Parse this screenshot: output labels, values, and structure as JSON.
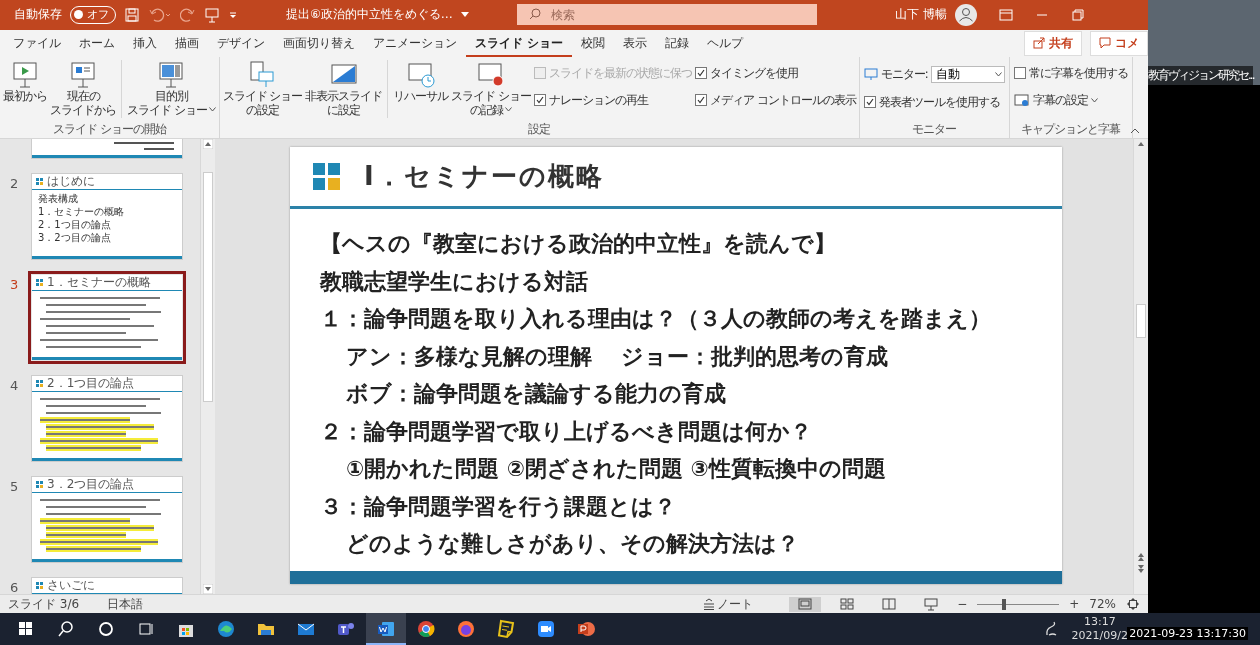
{
  "title_bar": {
    "autosave_label": "自動保存",
    "autosave_toggle": {
      "label": "オフ",
      "on": false
    },
    "document_title": "提出⑥政治的中立性をめぐる…",
    "search": {
      "placeholder": "検索"
    },
    "user_name": "山下 博暢"
  },
  "ribbon_tabs": [
    {
      "label": "ファイル",
      "selected": false
    },
    {
      "label": "ホーム",
      "selected": false
    },
    {
      "label": "挿入",
      "selected": false
    },
    {
      "label": "描画",
      "selected": false
    },
    {
      "label": "デザイン",
      "selected": false
    },
    {
      "label": "画面切り替え",
      "selected": false
    },
    {
      "label": "アニメーション",
      "selected": false
    },
    {
      "label": "スライド ショー",
      "selected": true
    },
    {
      "label": "校閲",
      "selected": false
    },
    {
      "label": "表示",
      "selected": false
    },
    {
      "label": "記録",
      "selected": false
    },
    {
      "label": "ヘルプ",
      "selected": false
    }
  ],
  "share_button": "共有",
  "comment_button": "コメ",
  "ribbon_groups": [
    {
      "label": "スライド ショーの開始",
      "items": [
        {
          "kind": "play",
          "lines": [
            "最初から"
          ]
        },
        {
          "kind": "current",
          "lines": [
            "現在の",
            "スライドから"
          ]
        },
        {
          "kind": "separator"
        },
        {
          "kind": "custom",
          "lines": [
            "目的別",
            "スライド ショー"
          ],
          "dropdown": true
        }
      ]
    },
    {
      "label": "設定",
      "items": [
        {
          "kind": "setup",
          "lines": [
            "スライド ショー",
            "の設定"
          ]
        },
        {
          "kind": "hide",
          "lines": [
            "非表示スライド",
            "に設定"
          ]
        },
        {
          "kind": "separator"
        },
        {
          "kind": "rehearse",
          "lines": [
            "リハーサル"
          ]
        },
        {
          "kind": "record",
          "lines": [
            "スライド ショー",
            "の記録"
          ],
          "dropdown": true
        },
        {
          "kind": "checks",
          "checks": [
            {
              "label": "スライドを最新の状態に保つ",
              "checked": false,
              "disabled": true
            },
            {
              "label": "ナレーションの再生",
              "checked": true,
              "disabled": false
            }
          ]
        },
        {
          "kind": "checks",
          "checks": [
            {
              "label": "タイミングを使用",
              "checked": true,
              "disabled": false
            },
            {
              "label": "メディア コントロールの表示",
              "checked": true,
              "disabled": false
            }
          ]
        }
      ]
    },
    {
      "label": "モニター",
      "items": [
        {
          "kind": "monitor",
          "label": "モニター:",
          "value": "自動",
          "check": {
            "label": "発表者ツールを使用する",
            "checked": true,
            "disabled": false
          }
        }
      ]
    },
    {
      "label": "キャプションと字幕",
      "items": [
        {
          "kind": "captions",
          "check": {
            "label": "常に字幕を使用する",
            "checked": false,
            "disabled": false
          },
          "button": "字幕の設定"
        }
      ]
    }
  ],
  "video": {
    "caption": "教育ヴィジョン研究セ..."
  },
  "thumbnails": [
    {
      "kind": "cover",
      "selected": false
    },
    {
      "kind": "text",
      "number": "2",
      "title": "はじめに",
      "lines": [
        "発表構成",
        "1．セミナーの概略",
        "2．1つ目の論点",
        "3．2つ目の論点"
      ],
      "selected": false
    },
    {
      "kind": "lines",
      "number": "3",
      "title": "1．セミナーの概略",
      "selected": true
    },
    {
      "kind": "lines",
      "number": "4",
      "title": "2．1つ目の論点",
      "selected": false,
      "highlighted": true
    },
    {
      "kind": "lines",
      "number": "5",
      "title": "3．2つ目の論点",
      "selected": false,
      "highlighted": true
    },
    {
      "kind": "partial",
      "number": "6",
      "title": "さいごに",
      "selected": false
    }
  ],
  "slide": {
    "title": "Ⅰ．セミナーの概略",
    "lines": [
      {
        "kind": "heading",
        "text": "【ヘスの『教室における政治的中立性』を読んで】"
      },
      {
        "kind": "heading",
        "text": "教職志望学生における対話"
      },
      {
        "kind": "heading",
        "text": "１：論争問題を取り入れる理由は？（３人の教師の考えを踏まえ）"
      },
      {
        "kind": "sub",
        "text": "アン：多様な見解の理解　 ジョー：批判的思考の育成"
      },
      {
        "kind": "sub",
        "text": "ボブ：論争問題を議論する能力の育成"
      },
      {
        "kind": "heading",
        "text": "２：論争問題学習で取り上げるべき問題は何か？"
      },
      {
        "kind": "sub",
        "text": "①開かれた問題 ②閉ざされた問題 ③性質転換中の問題"
      },
      {
        "kind": "heading",
        "text": "３：論争問題学習を行う課題とは？"
      },
      {
        "kind": "sub",
        "text": "どのような難しさがあり、その解決方法は？"
      }
    ]
  },
  "status_bar": {
    "slide_counter": "スライド 3/6",
    "language": "日本語",
    "notes_button": "ノート",
    "views": [
      {
        "kind": "normal",
        "selected": true
      },
      {
        "kind": "sorter",
        "selected": false
      },
      {
        "kind": "reading",
        "selected": false
      },
      {
        "kind": "presenter",
        "selected": false
      }
    ],
    "zoom_minus": "−",
    "zoom_plus": "+",
    "zoom": {
      "level": 0.33
    },
    "zoom_percent": "72%"
  },
  "taskbar": {
    "apps": [
      {
        "kind": "windows",
        "selected": false
      },
      {
        "kind": "search",
        "selected": false
      },
      {
        "kind": "cortana",
        "selected": false
      },
      {
        "kind": "taskview",
        "selected": false
      },
      {
        "kind": "store",
        "selected": false
      },
      {
        "kind": "edge",
        "selected": false
      },
      {
        "kind": "explorer",
        "selected": false
      },
      {
        "kind": "mail",
        "selected": false
      },
      {
        "kind": "teams",
        "selected": false
      },
      {
        "kind": "word",
        "selected": true
      },
      {
        "kind": "chrome",
        "selected": false
      },
      {
        "kind": "firefox",
        "selected": false
      },
      {
        "kind": "notes",
        "selected": false
      },
      {
        "kind": "zoom",
        "selected": false
      },
      {
        "kind": "powerpoint",
        "selected": false
      }
    ],
    "time": "13:17",
    "date": "2021/09/2"
  },
  "recording_timestamp": "2021-09-23 13:17:30"
}
